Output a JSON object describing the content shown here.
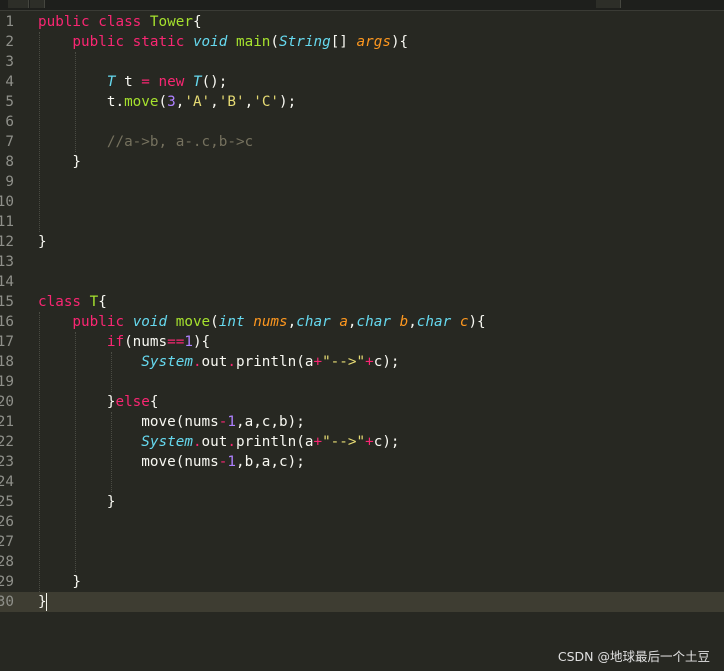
{
  "editor": {
    "line_numbers": [
      "1",
      "2",
      "3",
      "4",
      "5",
      "6",
      "7",
      "8",
      "9",
      "10",
      "11",
      "12",
      "13",
      "14",
      "15",
      "16",
      "17",
      "18",
      "19",
      "20",
      "21",
      "22",
      "23",
      "24",
      "25",
      "26",
      "27",
      "28",
      "29",
      "30"
    ],
    "current_line": "30",
    "lines": [
      [
        [
          "kw",
          "public class "
        ],
        [
          "cls",
          "Tower"
        ],
        [
          "",
          "{"
        ]
      ],
      [
        [
          "kw",
          "    public static "
        ],
        [
          "ty",
          "void "
        ],
        [
          "fn",
          "main"
        ],
        [
          "",
          "("
        ],
        [
          "ty",
          "String"
        ],
        [
          "",
          "[] "
        ],
        [
          "param",
          "args"
        ],
        [
          "",
          "){"
        ]
      ],
      [],
      [
        [
          "ty",
          "        T "
        ],
        [
          "",
          "t "
        ],
        [
          "kw",
          "= new "
        ],
        [
          "ty",
          "T"
        ],
        [
          "",
          "();"
        ]
      ],
      [
        [
          "",
          "        t."
        ],
        [
          "fn",
          "move"
        ],
        [
          "",
          "("
        ],
        [
          "num",
          "3"
        ],
        [
          "",
          ","
        ],
        [
          "str",
          "'A'"
        ],
        [
          "",
          ","
        ],
        [
          "str",
          "'B'"
        ],
        [
          "",
          ","
        ],
        [
          "str",
          "'C'"
        ],
        [
          "",
          ");"
        ]
      ],
      [],
      [
        [
          "cm",
          "        //a->b, a-.c,b->c"
        ]
      ],
      [
        [
          "",
          "    }"
        ]
      ],
      [],
      [],
      [],
      [
        [
          "",
          "}"
        ]
      ],
      [],
      [],
      [
        [
          "kw",
          "class "
        ],
        [
          "cls",
          "T"
        ],
        [
          "",
          "{"
        ]
      ],
      [
        [
          "kw",
          "    public "
        ],
        [
          "ty",
          "void "
        ],
        [
          "fn",
          "move"
        ],
        [
          "",
          "("
        ],
        [
          "ty",
          "int "
        ],
        [
          "param",
          "nums"
        ],
        [
          "",
          ","
        ],
        [
          "ty",
          "char "
        ],
        [
          "param",
          "a"
        ],
        [
          "",
          ","
        ],
        [
          "ty",
          "char "
        ],
        [
          "param",
          "b"
        ],
        [
          "",
          ","
        ],
        [
          "ty",
          "char "
        ],
        [
          "param",
          "c"
        ],
        [
          "",
          "){"
        ]
      ],
      [
        [
          "kw",
          "        if"
        ],
        [
          "",
          "(nums"
        ],
        [
          "kw",
          "=="
        ],
        [
          "num",
          "1"
        ],
        [
          "",
          "){"
        ]
      ],
      [
        [
          "ty",
          "            System"
        ],
        [
          "kw",
          "."
        ],
        [
          "",
          "out"
        ],
        [
          "kw",
          "."
        ],
        [
          "",
          "println(a"
        ],
        [
          "kw",
          "+"
        ],
        [
          "str",
          "\"-->\""
        ],
        [
          "kw",
          "+"
        ],
        [
          "",
          "c);"
        ]
      ],
      [],
      [
        [
          "",
          "        }"
        ],
        [
          "kw",
          "else"
        ],
        [
          "",
          "{"
        ]
      ],
      [
        [
          "",
          "            move(nums"
        ],
        [
          "kw",
          "-"
        ],
        [
          "num",
          "1"
        ],
        [
          "",
          ",a,c,b);"
        ]
      ],
      [
        [
          "ty",
          "            System"
        ],
        [
          "kw",
          "."
        ],
        [
          "",
          "out"
        ],
        [
          "kw",
          "."
        ],
        [
          "",
          "println(a"
        ],
        [
          "kw",
          "+"
        ],
        [
          "str",
          "\"-->\""
        ],
        [
          "kw",
          "+"
        ],
        [
          "",
          "c);"
        ]
      ],
      [
        [
          "",
          "            move(nums"
        ],
        [
          "kw",
          "-"
        ],
        [
          "num",
          "1"
        ],
        [
          "",
          ",b,a,c);"
        ]
      ],
      [],
      [
        [
          "",
          "        }"
        ]
      ],
      [],
      [],
      [],
      [
        [
          "",
          "    }"
        ]
      ],
      [
        [
          "",
          "}"
        ]
      ]
    ]
  },
  "watermark": "CSDN @地球最后一个土豆"
}
